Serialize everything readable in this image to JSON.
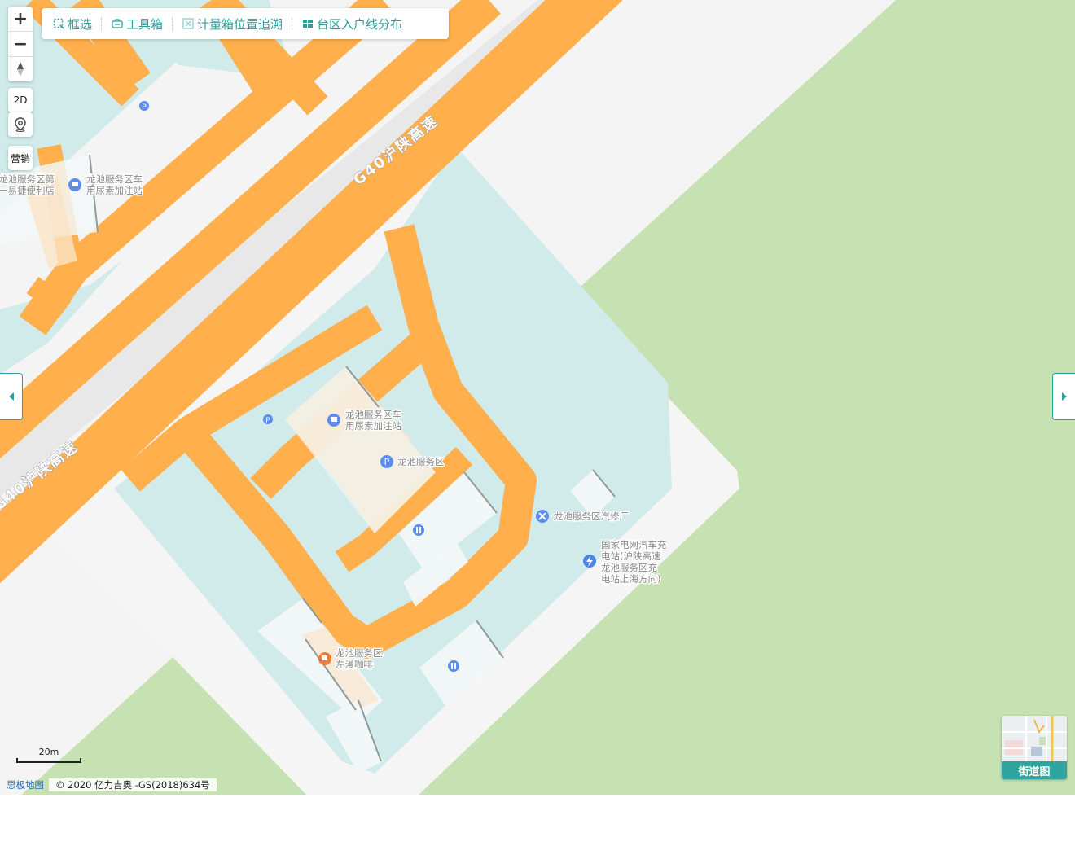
{
  "toolbar": {
    "items": [
      {
        "label": "框选",
        "icon": "box-select-icon"
      },
      {
        "label": "工具箱",
        "icon": "toolbox-icon"
      },
      {
        "label": "计量箱位置追溯",
        "icon": "meter-box-icon"
      },
      {
        "label": "台区入户线分布",
        "icon": "grid-layout-icon"
      }
    ]
  },
  "map_controls": {
    "zoom_in": "+",
    "zoom_out": "−",
    "mode_2d": "2D",
    "marketing": "营销"
  },
  "roads": {
    "highway_label_upper": "G40沪陕高速",
    "highway_label_lower": "G40沪陕高速"
  },
  "pois": {
    "store_upper": [
      "龙池服务区第",
      "一易捷便利店"
    ],
    "urea_upper": [
      "龙池服务区车",
      "用尿素加注站"
    ],
    "urea_lower": [
      "龙池服务区车",
      "用尿素加注站"
    ],
    "service_area": "龙池服务区",
    "repair_shop": "龙池服务区汽修厂",
    "charging_station": [
      "国家电网汽车充",
      "电站(沪陕高速",
      "龙池服务区充",
      "电站上海方向)"
    ],
    "cafe": [
      "龙池服务区",
      "左漫咖啡"
    ]
  },
  "scale": {
    "label": "20m"
  },
  "attribution": {
    "brand": "思极地图",
    "copyright": "© 2020 亿力吉奥 -GS(2018)634号"
  },
  "layer_switch": {
    "label": "街道图"
  },
  "colors": {
    "background_green": "#c6e2b3",
    "road_orange": "#ffaf4c",
    "parking_lot_teal": "#cfe9e8",
    "accent_teal": "#2e9e9a",
    "poi_blue": "#5b8def",
    "cafe_orange": "#f07a3a"
  }
}
